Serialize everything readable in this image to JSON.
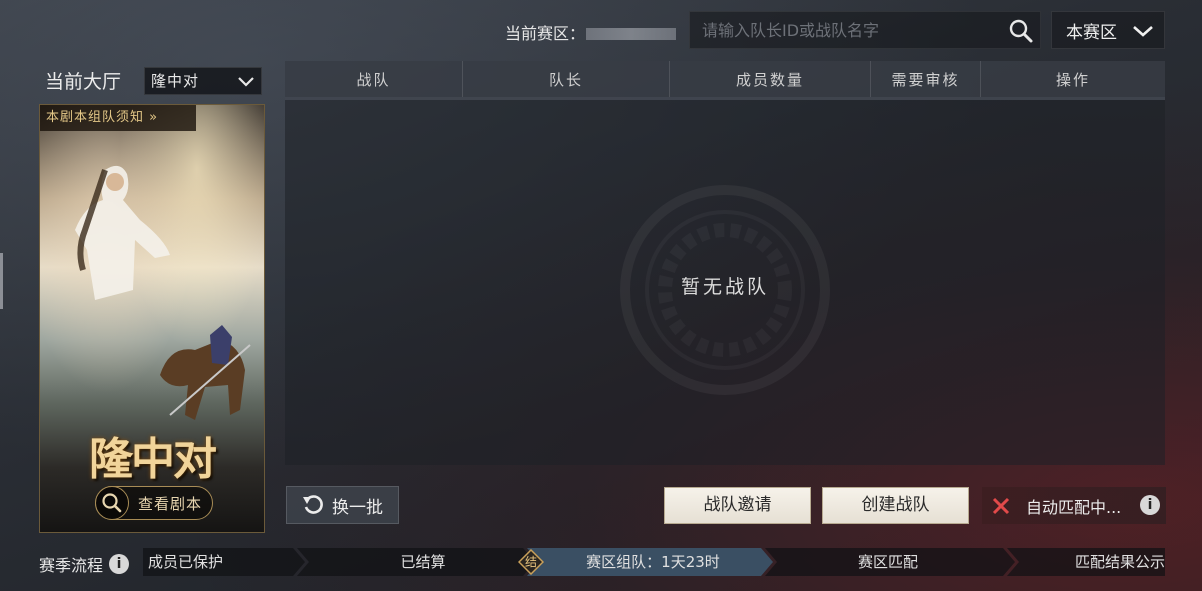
{
  "top": {
    "zone_label": "当前赛区：",
    "search_placeholder": "请输入队长ID或战队名字",
    "region_select": "本赛区"
  },
  "left": {
    "hall_label": "当前大厅",
    "hall_select": "隆中对",
    "poster": {
      "notice": "本剧本组队须知 »",
      "title": "隆中对",
      "view_button": "查看剧本"
    }
  },
  "table": {
    "columns": [
      "战队",
      "队长",
      "成员数量",
      "需要审核",
      "操作"
    ],
    "rows": [],
    "empty_text": "暂无战队"
  },
  "actions": {
    "refresh": "换一批",
    "invite": "战队邀请",
    "create": "创建战队",
    "automatch": "自动匹配中...",
    "automatch_info": "i"
  },
  "season": {
    "label": "赛季流程",
    "info": "i",
    "badge": "结",
    "stages": [
      {
        "label": "成员已保护"
      },
      {
        "label": "已结算"
      },
      {
        "label": "赛区组队：1天23时"
      },
      {
        "label": "赛区匹配"
      },
      {
        "label": "匹配结果公示"
      }
    ]
  },
  "colors": {
    "accent_gold": "#e4c888",
    "active_stage": "#3a4f63"
  }
}
